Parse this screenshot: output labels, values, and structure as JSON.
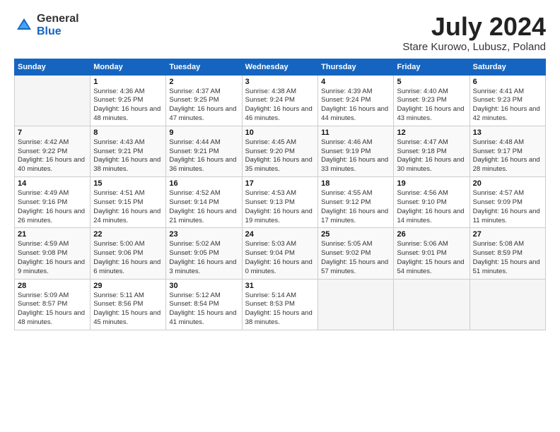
{
  "logo": {
    "general": "General",
    "blue": "Blue"
  },
  "title": "July 2024",
  "location": "Stare Kurowo, Lubusz, Poland",
  "days_of_week": [
    "Sunday",
    "Monday",
    "Tuesday",
    "Wednesday",
    "Thursday",
    "Friday",
    "Saturday"
  ],
  "weeks": [
    [
      {
        "day": "",
        "sunrise": "",
        "sunset": "",
        "daylight": ""
      },
      {
        "day": "1",
        "sunrise": "Sunrise: 4:36 AM",
        "sunset": "Sunset: 9:25 PM",
        "daylight": "Daylight: 16 hours and 48 minutes."
      },
      {
        "day": "2",
        "sunrise": "Sunrise: 4:37 AM",
        "sunset": "Sunset: 9:25 PM",
        "daylight": "Daylight: 16 hours and 47 minutes."
      },
      {
        "day": "3",
        "sunrise": "Sunrise: 4:38 AM",
        "sunset": "Sunset: 9:24 PM",
        "daylight": "Daylight: 16 hours and 46 minutes."
      },
      {
        "day": "4",
        "sunrise": "Sunrise: 4:39 AM",
        "sunset": "Sunset: 9:24 PM",
        "daylight": "Daylight: 16 hours and 44 minutes."
      },
      {
        "day": "5",
        "sunrise": "Sunrise: 4:40 AM",
        "sunset": "Sunset: 9:23 PM",
        "daylight": "Daylight: 16 hours and 43 minutes."
      },
      {
        "day": "6",
        "sunrise": "Sunrise: 4:41 AM",
        "sunset": "Sunset: 9:23 PM",
        "daylight": "Daylight: 16 hours and 42 minutes."
      }
    ],
    [
      {
        "day": "7",
        "sunrise": "Sunrise: 4:42 AM",
        "sunset": "Sunset: 9:22 PM",
        "daylight": "Daylight: 16 hours and 40 minutes."
      },
      {
        "day": "8",
        "sunrise": "Sunrise: 4:43 AM",
        "sunset": "Sunset: 9:21 PM",
        "daylight": "Daylight: 16 hours and 38 minutes."
      },
      {
        "day": "9",
        "sunrise": "Sunrise: 4:44 AM",
        "sunset": "Sunset: 9:21 PM",
        "daylight": "Daylight: 16 hours and 36 minutes."
      },
      {
        "day": "10",
        "sunrise": "Sunrise: 4:45 AM",
        "sunset": "Sunset: 9:20 PM",
        "daylight": "Daylight: 16 hours and 35 minutes."
      },
      {
        "day": "11",
        "sunrise": "Sunrise: 4:46 AM",
        "sunset": "Sunset: 9:19 PM",
        "daylight": "Daylight: 16 hours and 33 minutes."
      },
      {
        "day": "12",
        "sunrise": "Sunrise: 4:47 AM",
        "sunset": "Sunset: 9:18 PM",
        "daylight": "Daylight: 16 hours and 30 minutes."
      },
      {
        "day": "13",
        "sunrise": "Sunrise: 4:48 AM",
        "sunset": "Sunset: 9:17 PM",
        "daylight": "Daylight: 16 hours and 28 minutes."
      }
    ],
    [
      {
        "day": "14",
        "sunrise": "Sunrise: 4:49 AM",
        "sunset": "Sunset: 9:16 PM",
        "daylight": "Daylight: 16 hours and 26 minutes."
      },
      {
        "day": "15",
        "sunrise": "Sunrise: 4:51 AM",
        "sunset": "Sunset: 9:15 PM",
        "daylight": "Daylight: 16 hours and 24 minutes."
      },
      {
        "day": "16",
        "sunrise": "Sunrise: 4:52 AM",
        "sunset": "Sunset: 9:14 PM",
        "daylight": "Daylight: 16 hours and 21 minutes."
      },
      {
        "day": "17",
        "sunrise": "Sunrise: 4:53 AM",
        "sunset": "Sunset: 9:13 PM",
        "daylight": "Daylight: 16 hours and 19 minutes."
      },
      {
        "day": "18",
        "sunrise": "Sunrise: 4:55 AM",
        "sunset": "Sunset: 9:12 PM",
        "daylight": "Daylight: 16 hours and 17 minutes."
      },
      {
        "day": "19",
        "sunrise": "Sunrise: 4:56 AM",
        "sunset": "Sunset: 9:10 PM",
        "daylight": "Daylight: 16 hours and 14 minutes."
      },
      {
        "day": "20",
        "sunrise": "Sunrise: 4:57 AM",
        "sunset": "Sunset: 9:09 PM",
        "daylight": "Daylight: 16 hours and 11 minutes."
      }
    ],
    [
      {
        "day": "21",
        "sunrise": "Sunrise: 4:59 AM",
        "sunset": "Sunset: 9:08 PM",
        "daylight": "Daylight: 16 hours and 9 minutes."
      },
      {
        "day": "22",
        "sunrise": "Sunrise: 5:00 AM",
        "sunset": "Sunset: 9:06 PM",
        "daylight": "Daylight: 16 hours and 6 minutes."
      },
      {
        "day": "23",
        "sunrise": "Sunrise: 5:02 AM",
        "sunset": "Sunset: 9:05 PM",
        "daylight": "Daylight: 16 hours and 3 minutes."
      },
      {
        "day": "24",
        "sunrise": "Sunrise: 5:03 AM",
        "sunset": "Sunset: 9:04 PM",
        "daylight": "Daylight: 16 hours and 0 minutes."
      },
      {
        "day": "25",
        "sunrise": "Sunrise: 5:05 AM",
        "sunset": "Sunset: 9:02 PM",
        "daylight": "Daylight: 15 hours and 57 minutes."
      },
      {
        "day": "26",
        "sunrise": "Sunrise: 5:06 AM",
        "sunset": "Sunset: 9:01 PM",
        "daylight": "Daylight: 15 hours and 54 minutes."
      },
      {
        "day": "27",
        "sunrise": "Sunrise: 5:08 AM",
        "sunset": "Sunset: 8:59 PM",
        "daylight": "Daylight: 15 hours and 51 minutes."
      }
    ],
    [
      {
        "day": "28",
        "sunrise": "Sunrise: 5:09 AM",
        "sunset": "Sunset: 8:57 PM",
        "daylight": "Daylight: 15 hours and 48 minutes."
      },
      {
        "day": "29",
        "sunrise": "Sunrise: 5:11 AM",
        "sunset": "Sunset: 8:56 PM",
        "daylight": "Daylight: 15 hours and 45 minutes."
      },
      {
        "day": "30",
        "sunrise": "Sunrise: 5:12 AM",
        "sunset": "Sunset: 8:54 PM",
        "daylight": "Daylight: 15 hours and 41 minutes."
      },
      {
        "day": "31",
        "sunrise": "Sunrise: 5:14 AM",
        "sunset": "Sunset: 8:53 PM",
        "daylight": "Daylight: 15 hours and 38 minutes."
      },
      {
        "day": "",
        "sunrise": "",
        "sunset": "",
        "daylight": ""
      },
      {
        "day": "",
        "sunrise": "",
        "sunset": "",
        "daylight": ""
      },
      {
        "day": "",
        "sunrise": "",
        "sunset": "",
        "daylight": ""
      }
    ]
  ]
}
